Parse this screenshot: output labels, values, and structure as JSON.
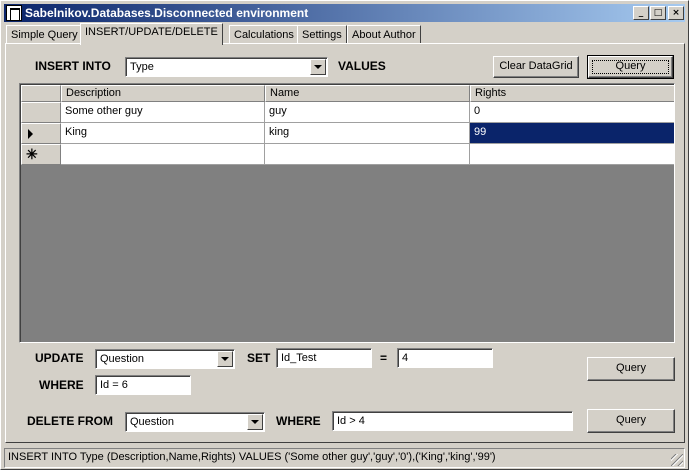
{
  "window": {
    "title": "Sabelnikov.Databases.Disconnected environment",
    "minimize": "_",
    "maximize": "□",
    "close": "×"
  },
  "tabs": [
    {
      "label": "Simple Query",
      "active": false
    },
    {
      "label": "INSERT/UPDATE/DELETE",
      "active": true
    },
    {
      "label": "Calculations",
      "active": false
    },
    {
      "label": "Settings",
      "active": false
    },
    {
      "label": "About Author",
      "active": false
    }
  ],
  "insert": {
    "label": "INSERT INTO",
    "table": "Type",
    "values_label": "VALUES",
    "clear_button": "Clear DataGrid",
    "query_button": "Query"
  },
  "grid": {
    "columns": [
      "Description",
      "Name",
      "Rights"
    ],
    "rows": [
      {
        "description": "Some other guy",
        "name": "guy",
        "rights": "0"
      },
      {
        "description": "King",
        "name": "king",
        "rights": "99"
      }
    ]
  },
  "update": {
    "label": "UPDATE",
    "table": "Question",
    "set_label": "SET",
    "set_field": "Id_Test",
    "eq": "=",
    "set_value": "4",
    "where_label": "WHERE",
    "where_value": "Id = 6",
    "query_button": "Query"
  },
  "delete": {
    "label": "DELETE FROM",
    "table": "Question",
    "where_label": "WHERE",
    "where_value": "Id > 4",
    "query_button": "Query"
  },
  "status": {
    "text": "INSERT INTO Type (Description,Name,Rights) VALUES ('Some other guy','guy','0'),('King','king','99')"
  },
  "colors": {
    "titlebar_start": "#0a246a",
    "titlebar_end": "#a6caf0",
    "selection": "#0a246a",
    "face": "#d4d0c8",
    "grid_bg": "#808080"
  }
}
